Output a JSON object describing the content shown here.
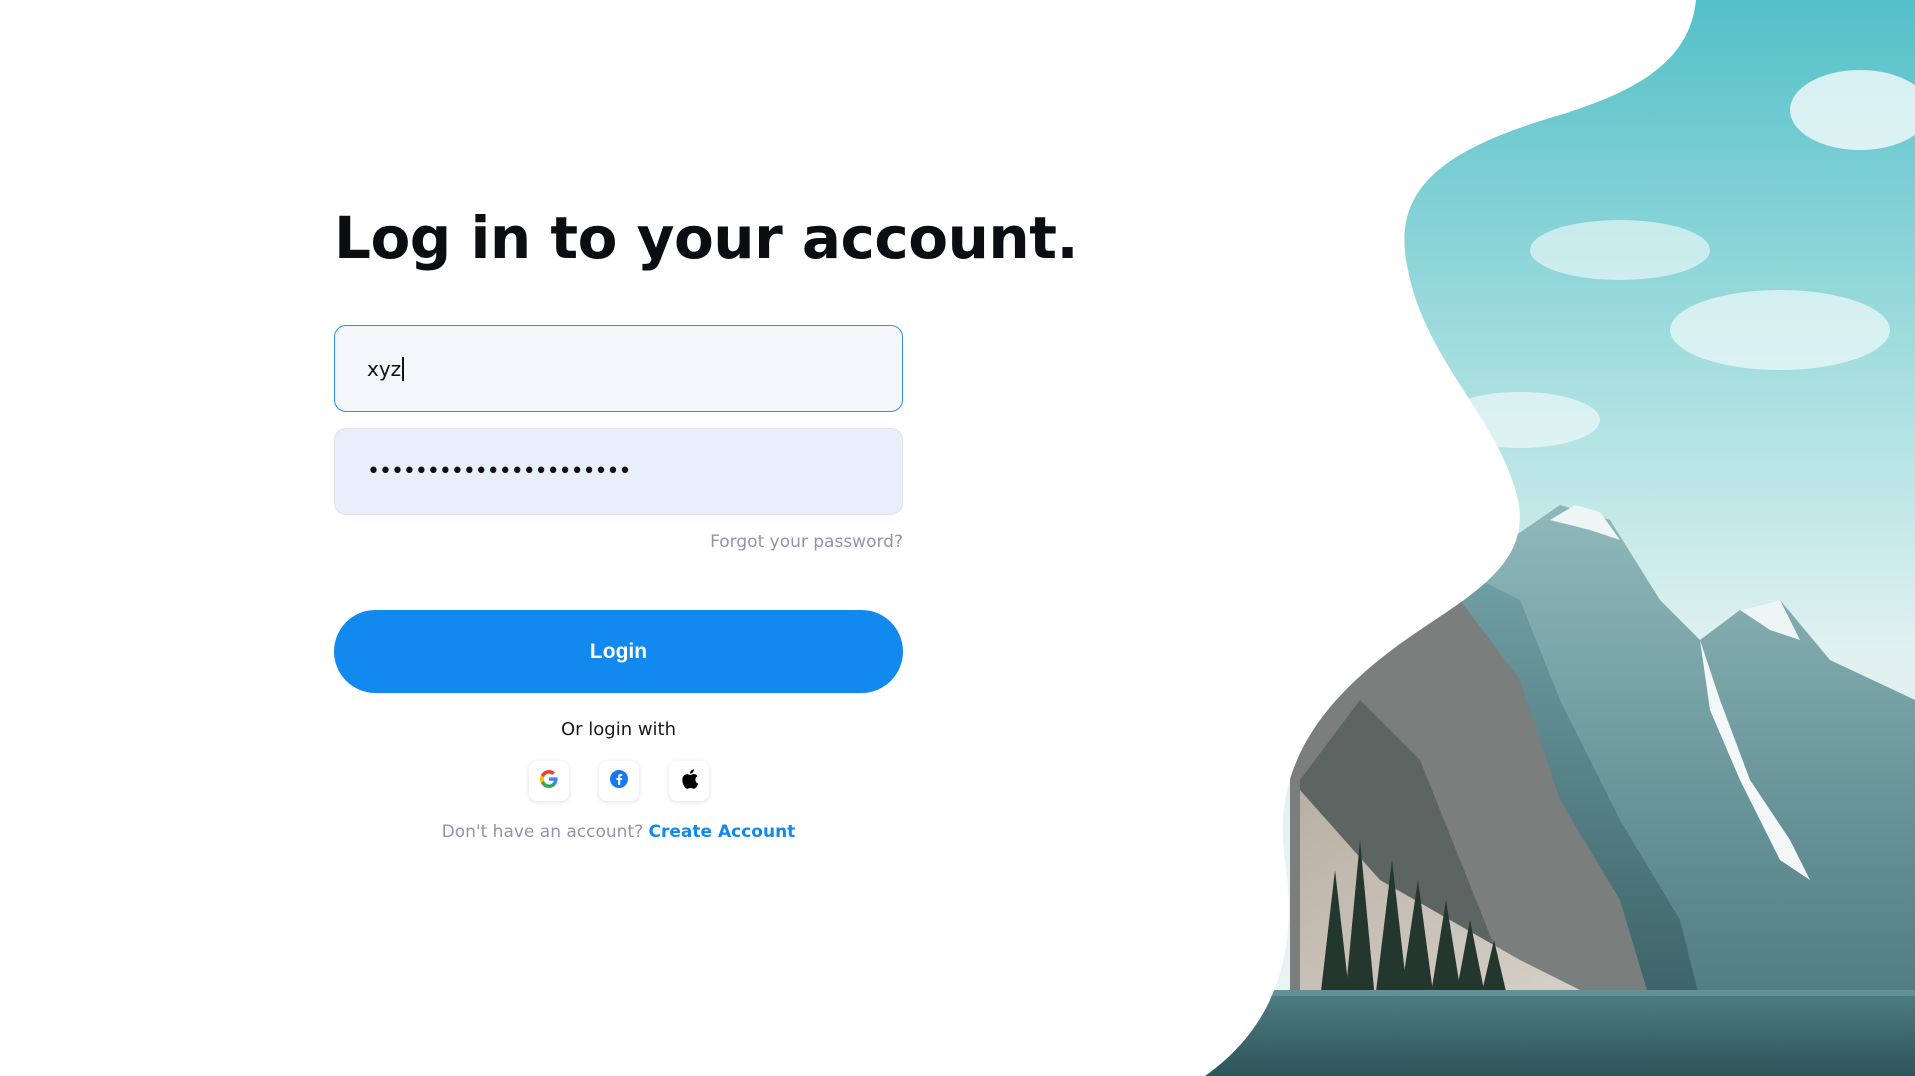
{
  "page": {
    "title": "Log in to your account."
  },
  "form": {
    "username_value": "xyz",
    "password_value": "••••••••••••••••••••••",
    "forgot_label": "Forgot your password?",
    "login_label": "Login",
    "or_login_with": "Or login with",
    "signup_prompt": "Don't have an account?",
    "create_account_label": "Create Account"
  },
  "social": [
    {
      "name": "google",
      "icon": "google-icon"
    },
    {
      "name": "facebook",
      "icon": "facebook-icon"
    },
    {
      "name": "apple",
      "icon": "apple-icon"
    }
  ],
  "colors": {
    "accent": "#1289ee",
    "focus_border": "#2f8fe3",
    "muted_text": "#8d97a8",
    "heading": "#0b0d12"
  }
}
